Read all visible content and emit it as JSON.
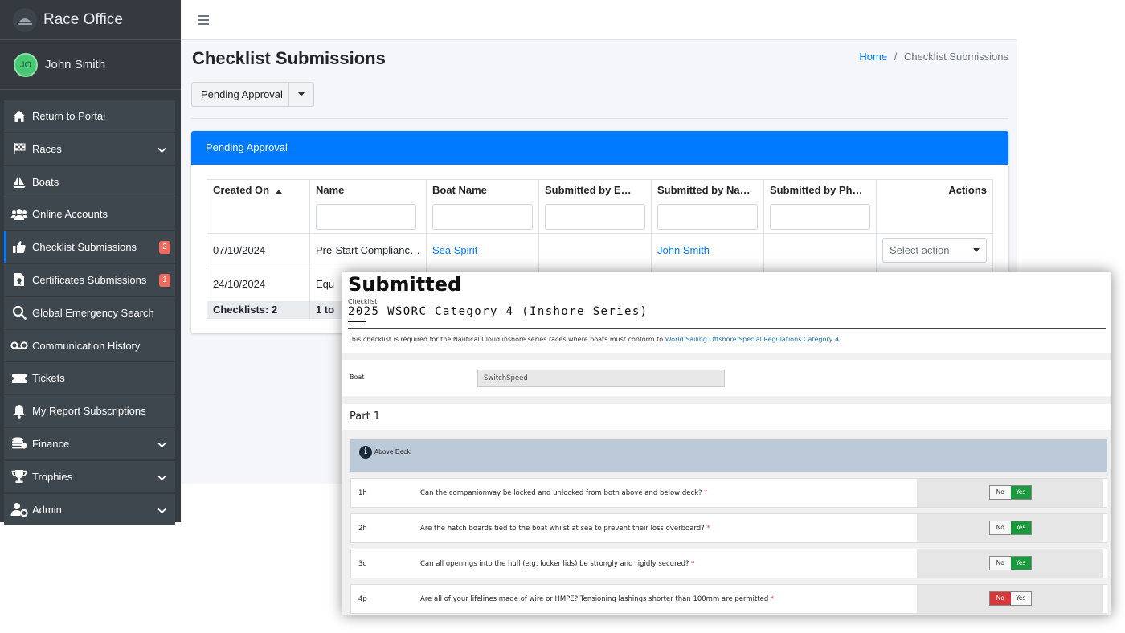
{
  "app": {
    "title": "Race Office"
  },
  "user": {
    "initials": "JO",
    "name": "John Smith"
  },
  "sidebar": {
    "items": [
      {
        "label": "Return to Portal",
        "icon": "home-icon"
      },
      {
        "label": "Races",
        "icon": "checkered-flag-icon"
      },
      {
        "label": "Boats",
        "icon": "sailboat-icon"
      },
      {
        "label": "Online Accounts",
        "icon": "users-icon"
      },
      {
        "label": "Checklist Submissions",
        "icon": "thumbs-up-icon",
        "badge": "2"
      },
      {
        "label": "Certificates Submissions",
        "icon": "certificate-icon",
        "badge": "1"
      },
      {
        "label": "Global Emergency Search",
        "icon": "search-icon"
      },
      {
        "label": "Communication History",
        "icon": "voicemail-icon"
      },
      {
        "label": "Tickets",
        "icon": "ticket-icon"
      },
      {
        "label": "My Report Subscriptions",
        "icon": "bell-icon"
      },
      {
        "label": "Finance",
        "icon": "coins-icon"
      },
      {
        "label": "Trophies",
        "icon": "trophy-icon"
      },
      {
        "label": "Admin",
        "icon": "user-cog-icon"
      }
    ]
  },
  "page": {
    "title": "Checklist Submissions",
    "breadcrumb": {
      "home": "Home",
      "separator": "/",
      "current": "Checklist Submissions"
    },
    "filter": "Pending Approval"
  },
  "card": {
    "title": "Pending Approval",
    "columns": [
      "Created On",
      "Name",
      "Boat Name",
      "Submitted by E…",
      "Submitted by Na…",
      "Submitted by Ph…",
      "Actions"
    ],
    "rows": [
      {
        "created": "07/10/2024",
        "name": "Pre-Start Complianc…",
        "boat": "Sea Spirit",
        "email": "",
        "submitter": "John Smith",
        "phone": "",
        "action": "Select action"
      },
      {
        "created": "24/10/2024",
        "name": "Equ",
        "boat": "",
        "email": "",
        "submitter": "",
        "phone": "",
        "action": ""
      }
    ],
    "footer": {
      "count": "Checklists: 2",
      "paging": "1 to"
    }
  },
  "overlay": {
    "heading": "Submitted",
    "checklist_label": "Checklist:",
    "checklist_name": "2025 WSORC Category 4 (Inshore Series)",
    "description": "This checklist is required for the Nautical Cloud inshore series races where boats must conform to ",
    "description_link": "World Sailing Offshore Special Regulations Category 4",
    "description_end": ".",
    "boat_label": "Boat",
    "boat_value": "SwitchSpeed",
    "part_title": "Part 1",
    "section_title": "Above Deck",
    "questions": [
      {
        "num": "1h",
        "text": "Can the companionway be locked and unlocked from both above and below deck?",
        "req": "*",
        "no": "No",
        "yes": "Yes",
        "answer": "Yes"
      },
      {
        "num": "2h",
        "text": "Are the hatch boards tied to the boat whilst at sea to prevent their loss overboard?",
        "req": "*",
        "no": "No",
        "yes": "Yes",
        "answer": "Yes"
      },
      {
        "num": "3c",
        "text": "Can all openings into the hull (e.g. locker lids) be strongly and rigidly secured?",
        "req": "*",
        "no": "No",
        "yes": "Yes",
        "answer": "Yes"
      },
      {
        "num": "4p",
        "text": "Are all of your lifelines made of wire or HMPE? Tensioning lashings shorter than 100mm are permitted",
        "req": "*",
        "no": "No",
        "yes": "Yes",
        "answer": "No"
      }
    ]
  },
  "colors": {
    "sidebar": "#343a40",
    "accent": "#007bff",
    "badge": "#f06b5e",
    "yes": "#1a9a3e",
    "no": "#d9383a"
  }
}
